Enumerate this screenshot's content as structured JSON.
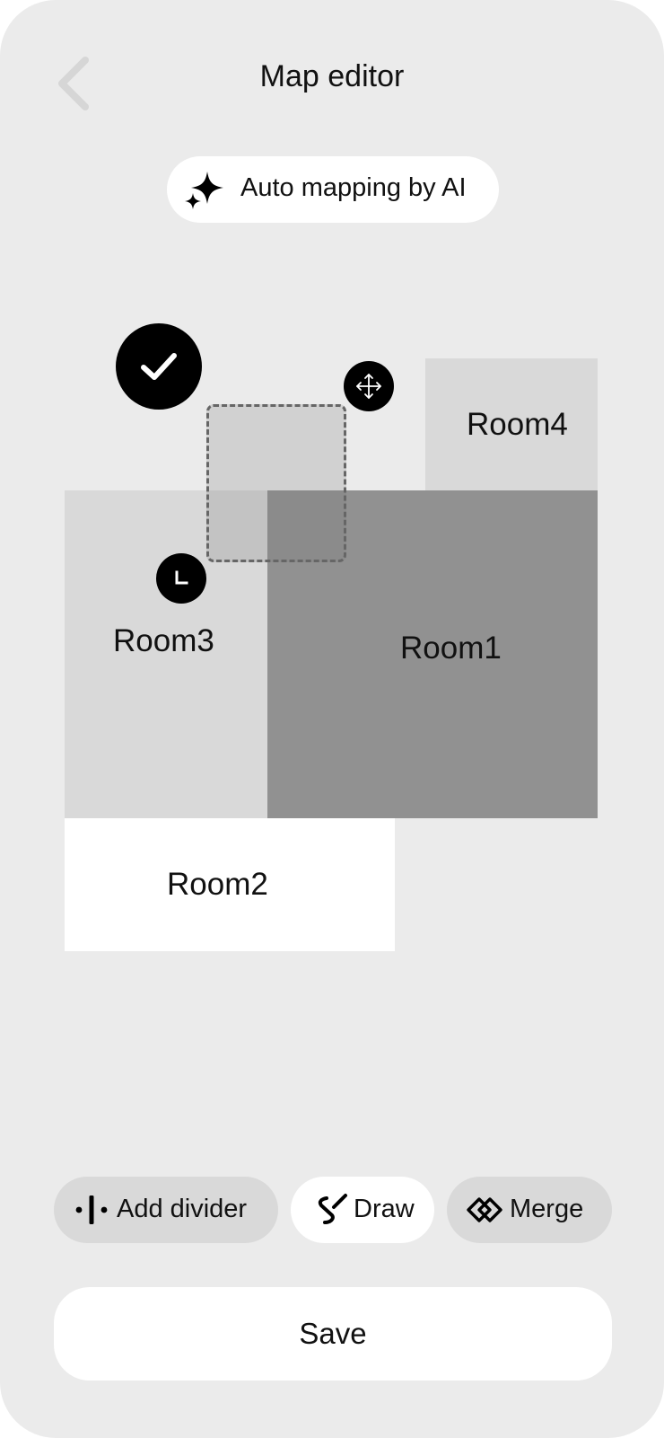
{
  "header": {
    "title": "Map editor",
    "back_icon": "chevron-left-icon"
  },
  "ai_button": {
    "label": "Auto mapping by AI",
    "icon": "sparkles-icon"
  },
  "rooms": [
    {
      "id": "room1",
      "label": "Room1",
      "color": "#919191"
    },
    {
      "id": "room2",
      "label": "Room2",
      "color": "#ffffff"
    },
    {
      "id": "room3",
      "label": "Room3",
      "color": "#d9d9d9"
    },
    {
      "id": "room4",
      "label": "Room4",
      "color": "#d9d9d9"
    }
  ],
  "selection": {
    "confirm_icon": "checkmark-icon",
    "move_icon": "move-arrows-icon",
    "resize_icon": "corner-resize-icon"
  },
  "tools": [
    {
      "id": "add-divider",
      "label": "Add divider",
      "icon": "divider-icon",
      "active": false
    },
    {
      "id": "draw",
      "label": "Draw",
      "icon": "pen-icon",
      "active": true
    },
    {
      "id": "merge",
      "label": "Merge",
      "icon": "merge-icon",
      "active": false
    }
  ],
  "save": {
    "label": "Save"
  },
  "colors": {
    "background": "#ebebeb",
    "surface": "#ffffff",
    "inactive_tool": "#d9d9d9",
    "accent": "#000000"
  }
}
